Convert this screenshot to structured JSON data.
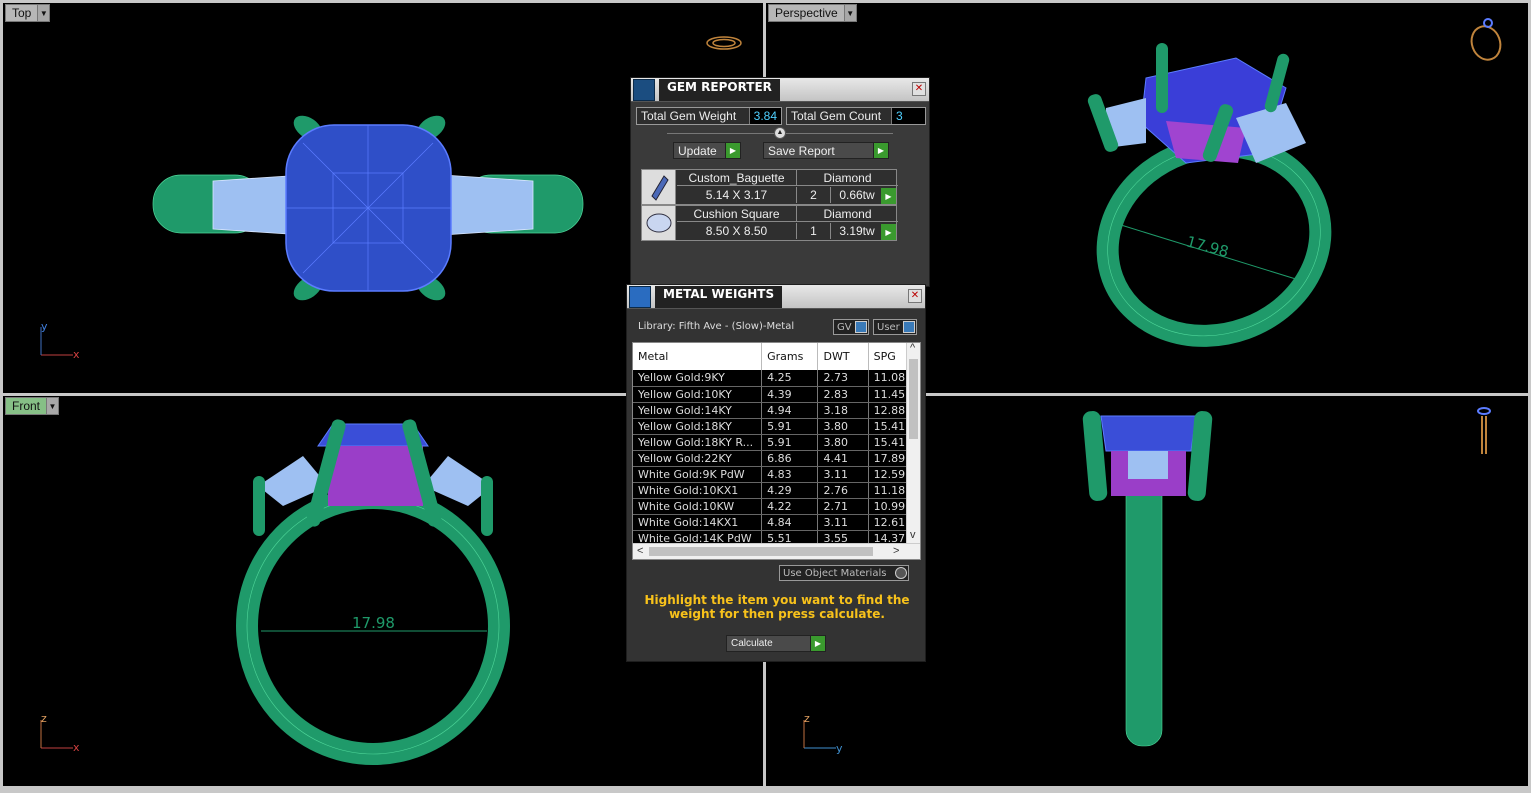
{
  "viewports": {
    "top": {
      "label": "Top"
    },
    "perspective": {
      "label": "Perspective"
    },
    "front": {
      "label": "Front"
    },
    "right": {
      "label": ""
    }
  },
  "dimensions": {
    "inner_diameter": "17.98"
  },
  "axes": {
    "x": "x",
    "y": "y",
    "z": "z"
  },
  "gem_reporter": {
    "title": "GEM REPORTER",
    "total_weight_label": "Total Gem Weight",
    "total_weight_value": "3.84",
    "total_count_label": "Total Gem Count",
    "total_count_value": "3",
    "update_label": "Update",
    "save_report_label": "Save Report",
    "gems": [
      {
        "name": "Custom_Baguette",
        "material": "Diamond",
        "size": "5.14 X 3.17",
        "qty": "2",
        "weight": "0.66tw"
      },
      {
        "name": "Cushion Square",
        "material": "Diamond",
        "size": "8.50 X 8.50",
        "qty": "1",
        "weight": "3.19tw"
      }
    ]
  },
  "metal_weights": {
    "title": "METAL WEIGHTS",
    "library": "Library: Fifth Ave - (Slow)-Metal",
    "toggle_gv": "GV",
    "toggle_user": "User",
    "columns": [
      "Metal",
      "Grams",
      "DWT",
      "SPG"
    ],
    "rows": [
      [
        "Yellow Gold:9KY",
        "4.25",
        "2.73",
        "11.08"
      ],
      [
        "Yellow Gold:10KY",
        "4.39",
        "2.83",
        "11.45"
      ],
      [
        "Yellow Gold:14KY",
        "4.94",
        "3.18",
        "12.88"
      ],
      [
        "Yellow Gold:18KY",
        "5.91",
        "3.80",
        "15.41"
      ],
      [
        "Yellow Gold:18KY R...",
        "5.91",
        "3.80",
        "15.41"
      ],
      [
        "Yellow Gold:22KY",
        "6.86",
        "4.41",
        "17.89"
      ],
      [
        "White Gold:9K PdW",
        "4.83",
        "3.11",
        "12.59"
      ],
      [
        "White Gold:10KX1",
        "4.29",
        "2.76",
        "11.18"
      ],
      [
        "White Gold:10KW",
        "4.22",
        "2.71",
        "10.99"
      ],
      [
        "White Gold:14KX1",
        "4.84",
        "3.11",
        "12.61"
      ],
      [
        "White Gold:14K PdW",
        "5.51",
        "3.55",
        "14.37"
      ]
    ],
    "use_object_materials": "Use Object Materials",
    "hint": "Highlight the item you want to find the weight for then press calculate.",
    "calculate_label": "Calculate"
  },
  "colors": {
    "ring": "#1f9a6a",
    "gem_blue": "#2f4fd6",
    "baguette": "#a9c8f0",
    "accent_green": "#3a9a2e",
    "hint_yellow": "#f8c21b"
  }
}
